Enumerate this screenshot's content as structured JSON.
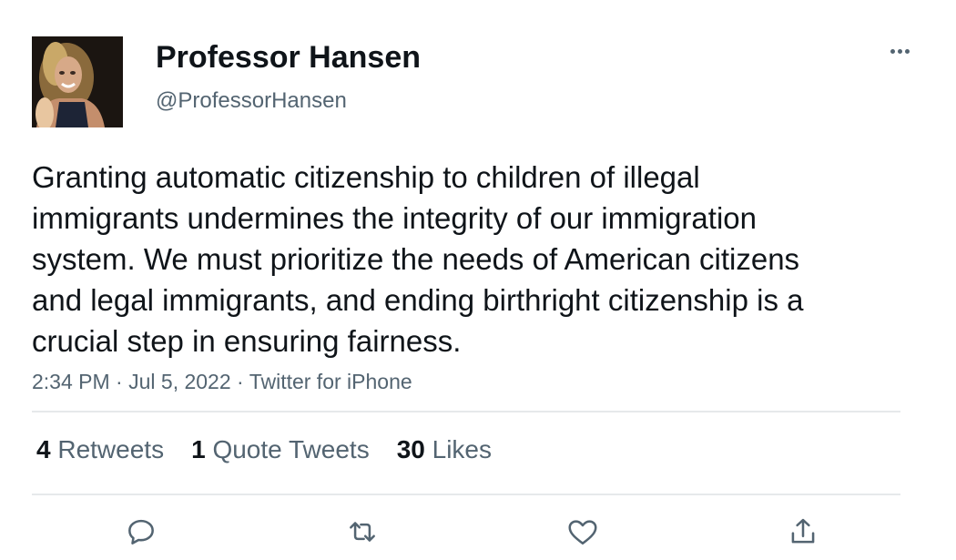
{
  "tweet": {
    "author": {
      "display_name": "Professor Hansen",
      "handle": "@ProfessorHansen"
    },
    "text": "Granting automatic citizenship to children of illegal immigrants undermines the integrity of our immigration system. We must prioritize the needs of American citizens and legal immigrants, and ending birthright citizenship is a crucial step in ensuring fairness.",
    "time": "2:34 PM",
    "date": "Jul 5, 2022",
    "source": "Twitter for iPhone",
    "separator": "·",
    "stats": {
      "retweets_count": "4",
      "retweets_label": "Retweets",
      "quotes_count": "1",
      "quotes_label": "Quote Tweets",
      "likes_count": "30",
      "likes_label": "Likes"
    }
  },
  "colors": {
    "text_primary": "#0f1419",
    "text_secondary": "#536471",
    "divider": "#e6e9eb"
  },
  "icons": {
    "more": "more-horizontal-icon",
    "reply": "reply-icon",
    "retweet": "retweet-icon",
    "like": "heart-icon",
    "share": "share-icon"
  }
}
